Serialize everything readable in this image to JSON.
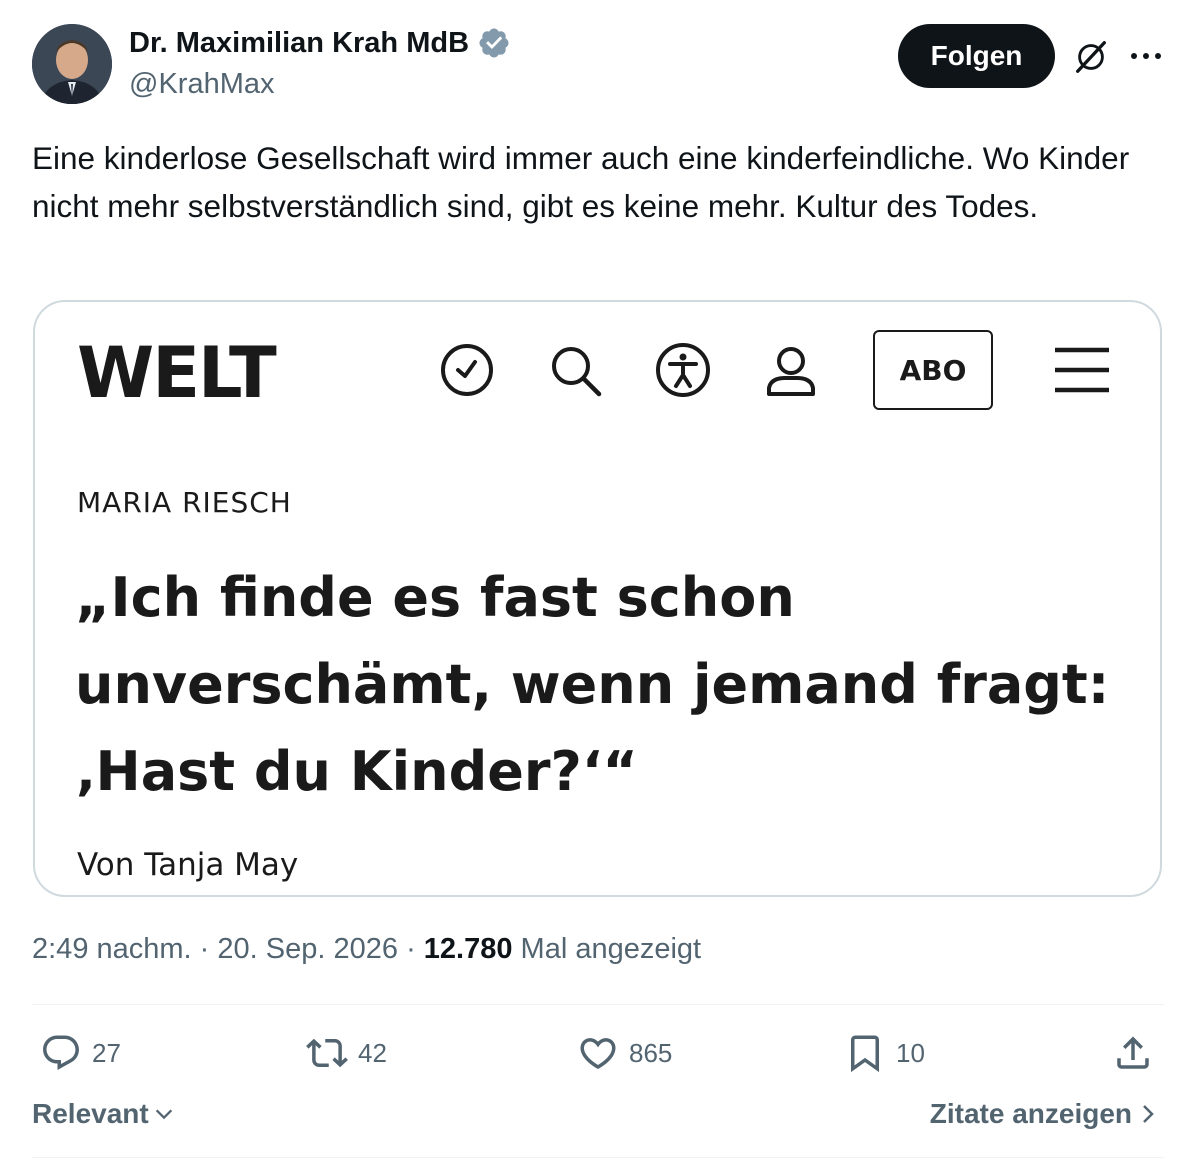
{
  "author": {
    "name": "Dr. Maximilian Krah MdB",
    "handle": "@KrahMax",
    "verified_badge_color": "#829aab"
  },
  "header": {
    "follow_label": "Folgen",
    "grok_icon": "grok-icon",
    "more_icon": "more-icon"
  },
  "tweet": {
    "text": "Eine kinderlose Gesellschaft wird immer auch eine kinderfeindliche. Wo Kinder nicht mehr selbstverständlich sind, gibt es keine mehr. Kultur des Todes."
  },
  "card": {
    "logo": "WELT",
    "abo_label": "ABO",
    "author_kicker": "MARIA RIESCH",
    "headline": "„Ich finde es fast schon unverschämt, wenn jemand fragt: ‚Hast du Kinder?‘“",
    "byline": "Von Tanja May"
  },
  "meta": {
    "time": "2:49 nachm.",
    "date": "20. Sep. 2026",
    "views_count": "12.780",
    "views_label": "Mal angezeigt"
  },
  "actions": {
    "replies": "27",
    "retweets": "42",
    "likes": "865",
    "bookmarks": "10"
  },
  "footer": {
    "sort_label": "Relevant",
    "quotes_label": "Zitate anzeigen"
  }
}
